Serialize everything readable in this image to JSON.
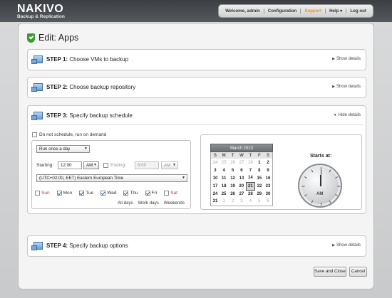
{
  "header": {
    "brand": "NAKIVO",
    "subtitle": "Backup & Replication",
    "nav": [
      "Welcome, admin",
      "Configuration",
      "Support",
      "Help",
      "Log out"
    ]
  },
  "page": {
    "title": "Edit: Apps"
  },
  "steps": [
    {
      "num": "STEP 1:",
      "label": "Choose VMs to backup",
      "toggle": "Show details"
    },
    {
      "num": "STEP 2:",
      "label": "Choose backup repository",
      "toggle": "Show details"
    },
    {
      "num": "STEP 3:",
      "label": "Specify backup schedule",
      "toggle": "Hide details"
    },
    {
      "num": "STEP 4:",
      "label": "Specify backup options",
      "toggle": "Show details"
    }
  ],
  "schedule": {
    "no_schedule_label": "Do not schedule, run on demand",
    "no_schedule_checked": false,
    "frequency": "Run once a day",
    "starting_label": "Starting:",
    "start_time": "12:00",
    "start_ampm": "AM",
    "ending_label": "Ending:",
    "end_time": "6:00",
    "end_ampm": "AM",
    "timezone": "(UTC+02:00, EET) Eastern European Time",
    "days": [
      {
        "label": "Sun",
        "checked": false
      },
      {
        "label": "Mon",
        "checked": true
      },
      {
        "label": "Tue",
        "checked": true
      },
      {
        "label": "Wed",
        "checked": true
      },
      {
        "label": "Thu",
        "checked": true
      },
      {
        "label": "Fri",
        "checked": true
      },
      {
        "label": "Sat",
        "checked": false
      }
    ],
    "quick_links": [
      "All days",
      "Work days",
      "Weekends"
    ]
  },
  "calendar": {
    "month": "March 2013",
    "dow": [
      "S",
      "M",
      "T",
      "W",
      "T",
      "F",
      "S"
    ],
    "weeks": [
      [
        "24",
        "25",
        "26",
        "27",
        "28",
        "1",
        "2"
      ],
      [
        "3",
        "4",
        "5",
        "6",
        "7",
        "8",
        "9"
      ],
      [
        "10",
        "11",
        "12",
        "13",
        "14",
        "15",
        "16"
      ],
      [
        "17",
        "18",
        "19",
        "20",
        "21",
        "22",
        "23"
      ],
      [
        "24",
        "25",
        "26",
        "27",
        "28",
        "29",
        "30"
      ],
      [
        "31",
        "1",
        "2",
        "3",
        "4",
        "5",
        "6"
      ]
    ],
    "today": "21"
  },
  "clock": {
    "label": "Starts at:",
    "ampm": "AM"
  },
  "footer": {
    "save_label": "Save and Close",
    "cancel_label": "Cancel"
  },
  "colors": {
    "accent": "#e8921e",
    "success": "#3a9a2e",
    "weekend": "#c0392b"
  }
}
